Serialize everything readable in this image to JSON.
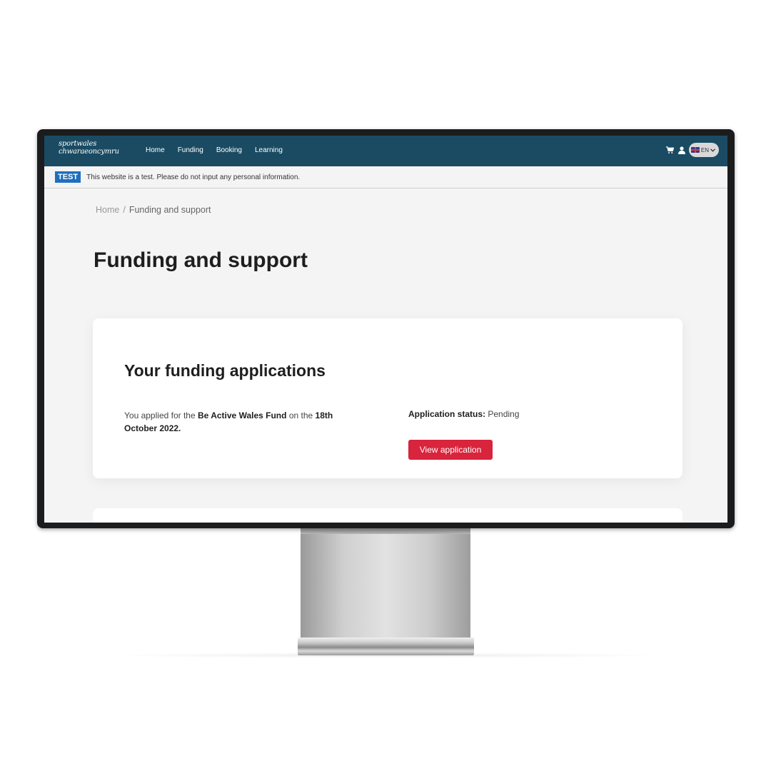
{
  "header": {
    "logo_line1": "sportwales",
    "logo_line2": "chwaraeoncymru",
    "nav": [
      "Home",
      "Funding",
      "Booking",
      "Learning"
    ],
    "cart_icon": "cart-icon",
    "user_icon": "user-icon",
    "language": "EN"
  },
  "banner": {
    "badge": "TEST",
    "message": "This website is a test. Please do not input any personal information."
  },
  "breadcrumb": {
    "home": "Home",
    "separator": "/",
    "current": "Funding and support"
  },
  "page_title": "Funding and support",
  "applications": {
    "heading": "Your funding applications",
    "intro": "You applied for the",
    "fund_name": "Be Active Wales Fund",
    "on_the": "on the",
    "date": "18th October 2022.",
    "status_label": "Application status:",
    "status_value": "Pending",
    "button_label": "View application"
  },
  "colors": {
    "header_bg": "#1a4b63",
    "test_badge": "#1f6fbf",
    "button": "#d8243c"
  }
}
